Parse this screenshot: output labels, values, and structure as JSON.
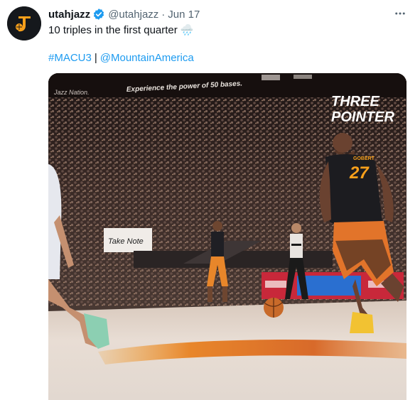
{
  "tweet": {
    "display_name": "utahjazz",
    "handle": "@utahjazz",
    "separator": "·",
    "date": "Jun 17",
    "text": "10 triples in the first quarter 🌧️",
    "hashtag": "#MACU3",
    "divider": "|",
    "mention": "@MountainAmerica",
    "more_icon": "more-options-icon",
    "verified_icon": "verified-badge-icon"
  },
  "media": {
    "overlay_line1": "THREE",
    "overlay_line2": "POINTER",
    "jersey_name": "GOBERT",
    "jersey_number": "27",
    "courtside_sign": "Take Note",
    "banner_text": "Experience the power of 50 bases.",
    "corner_text": "Jazz Nation."
  },
  "colors": {
    "link": "#1d9bf0",
    "secondary_text": "#536471",
    "jazz_yellow": "#f9a01b",
    "jazz_black": "#15181c"
  }
}
